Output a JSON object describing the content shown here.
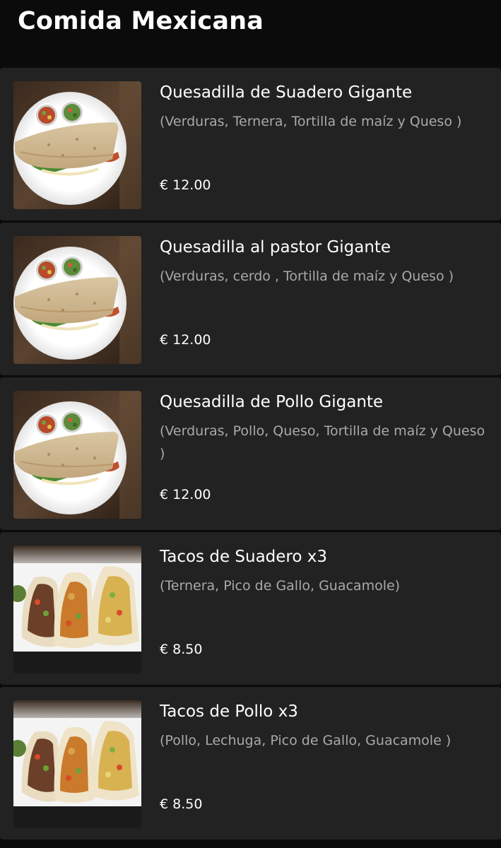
{
  "header": {
    "title": "Comida Mexicana"
  },
  "items": [
    {
      "name": "Quesadilla de Suadero Gigante",
      "description": "(Verduras, Ternera, Tortilla de maíz y Queso )",
      "price": "€ 12.00",
      "image": "quesadilla-photo"
    },
    {
      "name": "Quesadilla al pastor Gigante",
      "description": "(Verduras, cerdo , Tortilla de maíz y Queso )",
      "price": "€ 12.00",
      "image": "quesadilla-photo"
    },
    {
      "name": "Quesadilla de Pollo Gigante",
      "description": "(Verduras, Pollo, Queso, Tortilla de maíz y Queso )",
      "price": "€ 12.00",
      "image": "quesadilla-photo"
    },
    {
      "name": "Tacos de Suadero x3",
      "description": "(Ternera, Pico de Gallo, Guacamole)",
      "price": "€ 8.50",
      "image": "tacos-photo"
    },
    {
      "name": "Tacos de Pollo x3",
      "description": "(Pollo, Lechuga, Pico de Gallo, Guacamole )",
      "price": "€ 8.50",
      "image": "tacos-photo"
    }
  ]
}
